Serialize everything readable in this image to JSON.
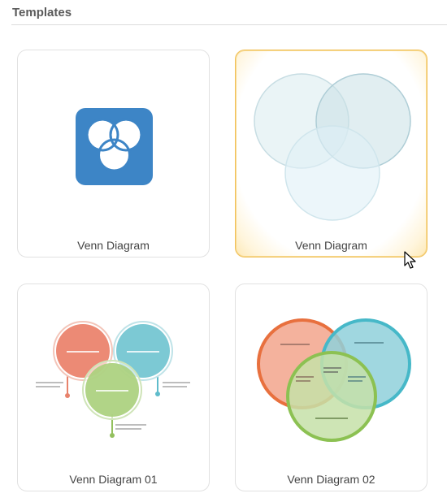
{
  "section": {
    "title": "Templates"
  },
  "templates": [
    {
      "label": "Venn Diagram",
      "selected": false
    },
    {
      "label": "Venn Diagram",
      "selected": true
    },
    {
      "label": "Venn Diagram 01",
      "selected": false
    },
    {
      "label": "Venn Diagram 02",
      "selected": false
    }
  ],
  "colors": {
    "icon_blue": "#3d85c6",
    "selection_border": "#f1c15a",
    "venn01_red": "#ec8a75",
    "venn01_teal": "#7cc9d4",
    "venn01_green": "#a8cf7a",
    "venn02_orange": "#e8703e",
    "venn02_teal": "#46b8c8",
    "venn02_green": "#8cc152"
  },
  "icons": [
    "venn-app-icon",
    "mouse-pointer-icon"
  ]
}
